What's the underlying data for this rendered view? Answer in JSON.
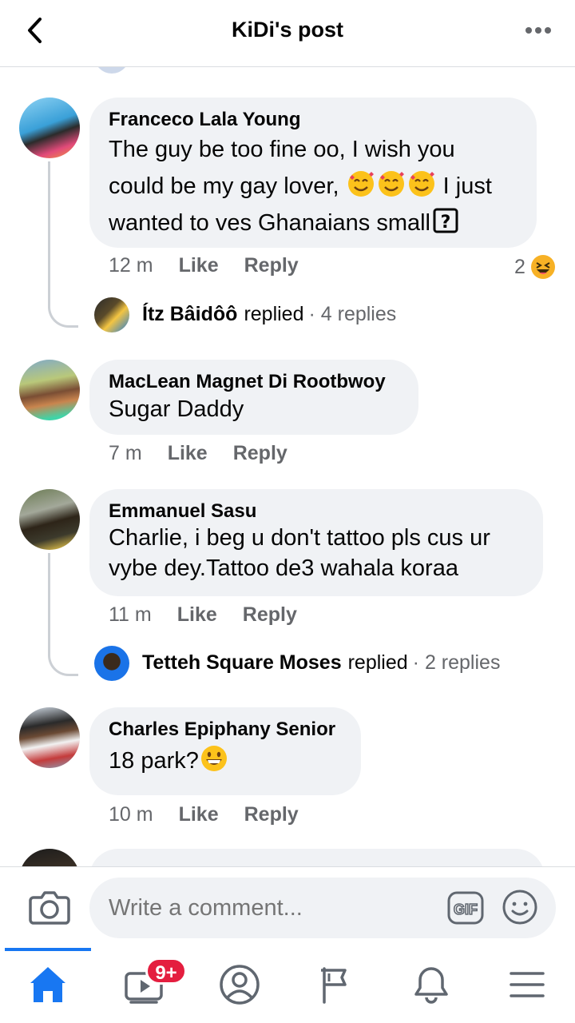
{
  "header": {
    "title": "KiDi's post"
  },
  "comments": [
    {
      "name": "Franceco Lala Young",
      "lines": [
        "The guy be too fine oo, I wish you",
        "could be my gay lover, ",
        " I just",
        "wanted to ves Ghanaians small"
      ],
      "time": "12 m",
      "like": "Like",
      "reply": "Reply",
      "reaction_count": "2",
      "replied": {
        "name": "Ítz Bâidôô",
        "verb": "replied",
        "count": "· 4 replies"
      }
    },
    {
      "name": "MacLean Magnet Di Rootbwoy",
      "lines": [
        "Sugar Daddy"
      ],
      "time": "7 m",
      "like": "Like",
      "reply": "Reply"
    },
    {
      "name": "Emmanuel Sasu",
      "lines": [
        "Charlie, i beg u don't tattoo pls cus ur",
        "vybe dey.Tattoo de3 wahala koraa"
      ],
      "time": "11 m",
      "like": "Like",
      "reply": "Reply",
      "replied": {
        "name": "Tetteh Square Moses",
        "verb": "replied",
        "count": "· 2 replies"
      }
    },
    {
      "name": "Charles Epiphany Senior",
      "lines": [
        "18 park?"
      ],
      "time": "10 m",
      "like": "Like",
      "reply": "Reply"
    }
  ],
  "composer": {
    "placeholder": "Write a comment..."
  },
  "tabbar": {
    "video_badge": "9+"
  },
  "colors": {
    "accent": "#1877f2",
    "bubble": "#f0f2f5",
    "meta": "#65676b",
    "badge": "#e41e3f"
  },
  "icons": [
    "back-arrow-icon",
    "more-dots-icon",
    "laughing-emoji-icon",
    "smiling-hearts-emoji-icon",
    "grinning-emoji-icon",
    "camera-icon",
    "gif-icon",
    "smiley-icon",
    "home-icon",
    "video-icon",
    "profile-icon",
    "pages-flag-icon",
    "bell-icon",
    "menu-icon"
  ]
}
